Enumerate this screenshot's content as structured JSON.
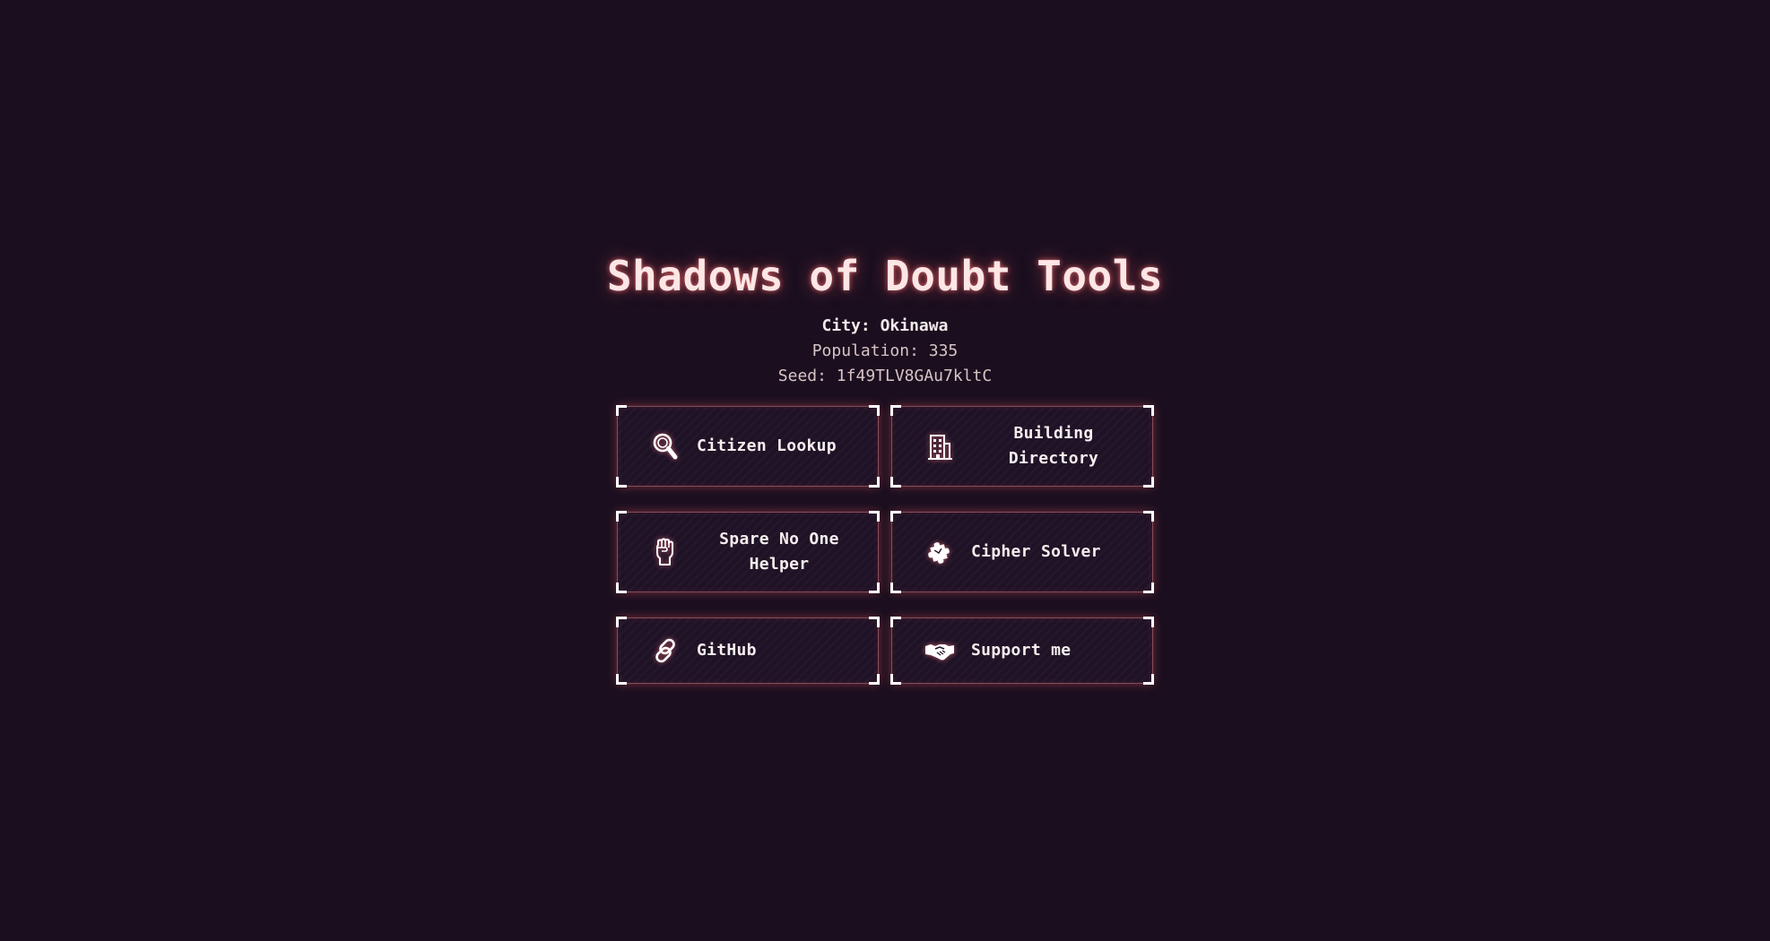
{
  "header": {
    "title": "Shadows of Doubt Tools",
    "city": "City: Okinawa",
    "population": "Population: 335",
    "seed": "Seed: 1f49TLV8GAu7kltC"
  },
  "tools": [
    {
      "label": "Citizen Lookup",
      "icon": "magnifying-glass-icon"
    },
    {
      "label": "Building Directory",
      "icon": "building-icon"
    },
    {
      "label": "Spare No One Helper",
      "icon": "raised-fist-icon"
    },
    {
      "label": "Cipher Solver",
      "icon": "puzzle-piece-icon"
    },
    {
      "label": "GitHub",
      "icon": "link-icon"
    },
    {
      "label": "Support me",
      "icon": "handshake-icon"
    }
  ],
  "colors": {
    "background": "#1b0f1f",
    "card_background": "#1f1226",
    "glow": "#e65a64",
    "title_text": "#fde6e6"
  }
}
